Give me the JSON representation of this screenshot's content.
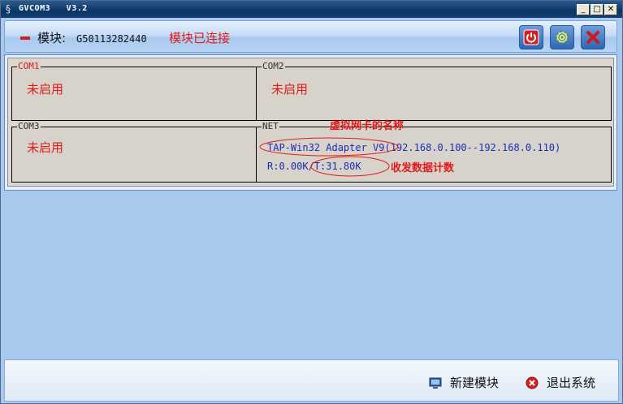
{
  "window": {
    "title": "GVCOM3   V3.2",
    "minimize": "_",
    "maximize": "□",
    "close": "✕"
  },
  "header": {
    "module_label": "模块:",
    "module_id": "G50113282440",
    "status": "模块已连接"
  },
  "ports": [
    {
      "legend": "COM1",
      "state": "未启用"
    },
    {
      "legend": "COM2",
      "state": "未启用"
    },
    {
      "legend": "COM3",
      "state": "未启用"
    },
    {
      "legend": "NET",
      "adapter": "TAP-Win32 Adapter V9",
      "ip_range": "(192.168.0.100--192.168.0.110)",
      "traffic": "R:0.00K/T:31.80K"
    }
  ],
  "annotations": {
    "adapter_name": "虚拟网卡的名称",
    "traffic_count": "收发数据计数"
  },
  "footer": {
    "new_module": "新建模块",
    "exit_system": "退出系统"
  },
  "colors": {
    "status_red": "#e21a1a",
    "net_blue": "#1c2db8",
    "titlebar": "#0b3566"
  }
}
